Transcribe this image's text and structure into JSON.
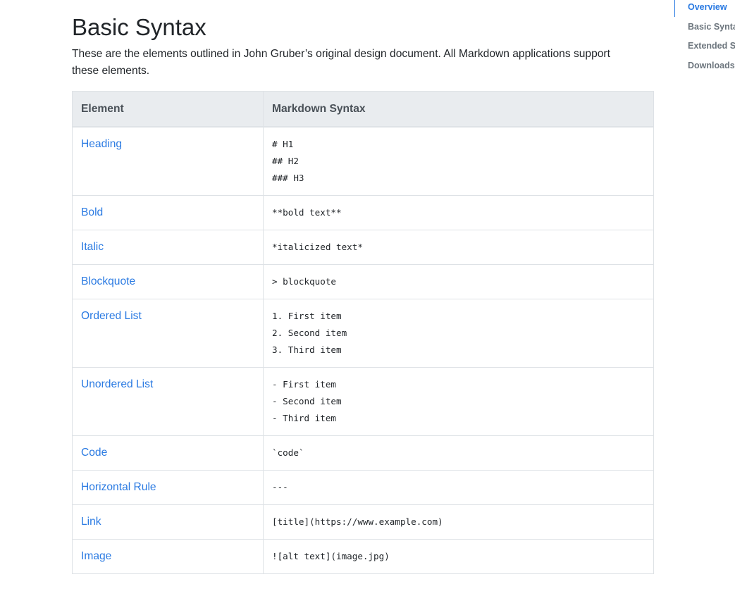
{
  "page": {
    "title": "Basic Syntax",
    "intro": "These are the elements outlined in John Gruber’s original design document. All Markdown applications support these elements."
  },
  "table": {
    "headers": [
      "Element",
      "Markdown Syntax"
    ],
    "rows": [
      {
        "element": "Heading",
        "syntax": [
          "# H1",
          "## H2",
          "### H3"
        ]
      },
      {
        "element": "Bold",
        "syntax": [
          "**bold text**"
        ]
      },
      {
        "element": "Italic",
        "syntax": [
          "*italicized text*"
        ]
      },
      {
        "element": "Blockquote",
        "syntax": [
          "> blockquote"
        ]
      },
      {
        "element": "Ordered List",
        "syntax": [
          "1. First item",
          "2. Second item",
          "3. Third item"
        ]
      },
      {
        "element": "Unordered List",
        "syntax": [
          "- First item",
          "- Second item",
          "- Third item"
        ]
      },
      {
        "element": "Code",
        "syntax": [
          "`code`"
        ]
      },
      {
        "element": "Horizontal Rule",
        "syntax": [
          "---"
        ]
      },
      {
        "element": "Link",
        "syntax": [
          "[title](https://www.example.com)"
        ]
      },
      {
        "element": "Image",
        "syntax": [
          "![alt text](image.jpg)"
        ]
      }
    ]
  },
  "toc": {
    "items": [
      {
        "label": "Overview",
        "active": true
      },
      {
        "label": "Basic Syntax",
        "active": false
      },
      {
        "label": "Extended Syntax",
        "active": false
      },
      {
        "label": "Downloads",
        "active": false
      }
    ]
  },
  "colors": {
    "link": "#2a7ae2",
    "header_bg": "#e9ecef",
    "border": "#dee2e6",
    "toc_muted": "#6c757d"
  }
}
